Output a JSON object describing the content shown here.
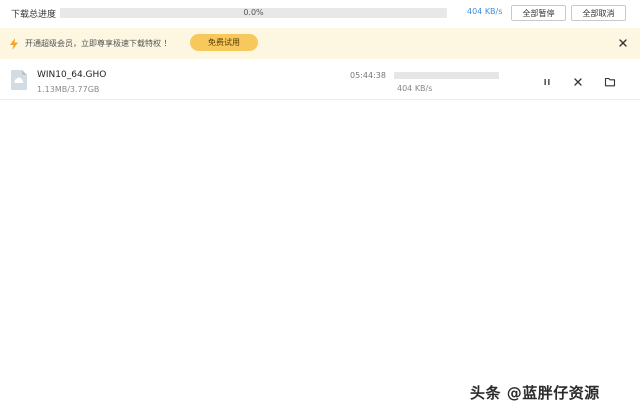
{
  "toolbar": {
    "total_progress_label": "下载总进度",
    "total_progress_text": "0.0%",
    "total_progress_fraction": 0.0,
    "total_speed": "404 KB/s",
    "pause_all_label": "全部暂停",
    "cancel_all_label": "全部取消"
  },
  "promo": {
    "icon": "lightning-icon",
    "text": "开通超级会员，立即尊享极速下载特权 ！",
    "trial_button_label": "免费试用",
    "close_icon": "close-icon"
  },
  "downloads": [
    {
      "icon": "file-icon",
      "name": "WIN10_64.GHO",
      "size": "1.13MB/3.77GB",
      "time_left": "05:44:38",
      "progress_fraction": 0.0003,
      "speed": "404 KB/s",
      "actions": [
        "pause-icon",
        "delete-icon",
        "folder-icon"
      ]
    }
  ],
  "watermark": {
    "text": "头条 @蓝胖仔资源"
  },
  "colors": {
    "accent": "#3f9cf0",
    "speed_text": "#3f8fd9",
    "promo_bg": "#fdf6e1",
    "trial_button": "#f7c95c"
  }
}
